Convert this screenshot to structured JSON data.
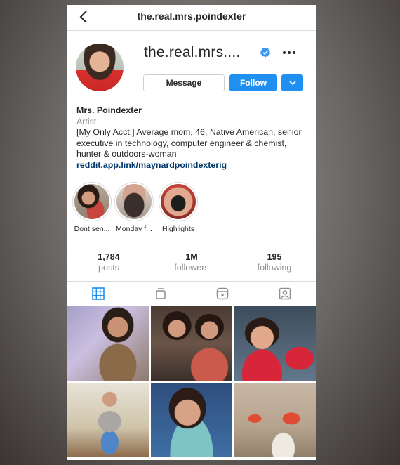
{
  "header": {
    "title": "the.real.mrs.poindexter"
  },
  "profile": {
    "username_display": "the.real.mrs....",
    "verified": true,
    "buttons": {
      "message": "Message",
      "follow": "Follow"
    },
    "bio": {
      "name": "Mrs. Poindexter",
      "category": "Artist",
      "text": "[My Only Acct!] Average mom, 46, Native American, senior executive in technology, computer engineer & chemist, hunter & outdoors-woman",
      "link": "reddit.app.link/maynardpoindexterig"
    }
  },
  "highlights": [
    {
      "label": "Dont sen..."
    },
    {
      "label": "Monday f..."
    },
    {
      "label": "Highlights"
    }
  ],
  "stats": [
    {
      "value": "1,784",
      "label": "posts"
    },
    {
      "value": "1M",
      "label": "followers"
    },
    {
      "value": "195",
      "label": "following"
    }
  ],
  "tabs": [
    {
      "icon": "grid-icon",
      "active": true
    },
    {
      "icon": "igtv-icon",
      "active": false
    },
    {
      "icon": "reels-icon",
      "active": false
    },
    {
      "icon": "tagged-icon",
      "active": false
    }
  ],
  "colors": {
    "accent": "#1f8ff2",
    "link": "#00376b",
    "secondary_text": "#8e8e8e"
  }
}
